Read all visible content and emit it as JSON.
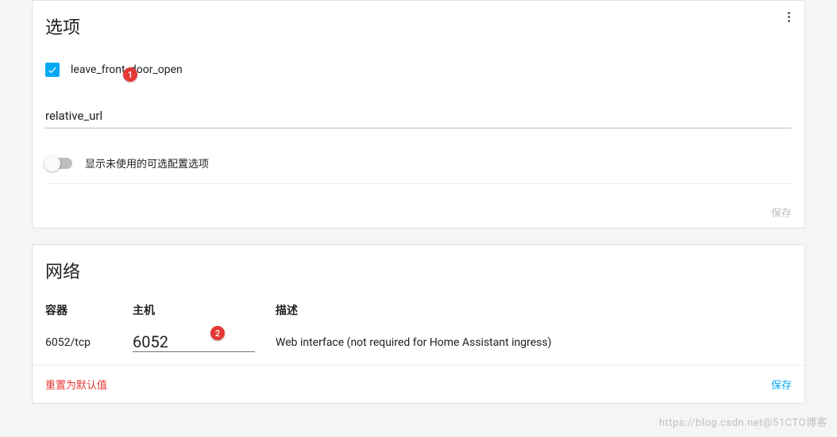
{
  "options": {
    "title": "选项",
    "checkbox_label": "leave_front_door_open",
    "checkbox_checked": true,
    "badge1": "1",
    "input_value": "relative_url",
    "toggle_label": "显示未使用的可选配置选项",
    "save": "保存"
  },
  "network": {
    "title": "网络",
    "header_container": "容器",
    "header_host": "主机",
    "header_desc": "描述",
    "row_container": "6052/tcp",
    "row_host": "6052",
    "row_desc": "Web interface (not required for Home Assistant ingress)",
    "badge2": "2",
    "reset": "重置为默认值",
    "save": "保存"
  },
  "watermark": "https://blog.csdn.net@51CTO博客"
}
